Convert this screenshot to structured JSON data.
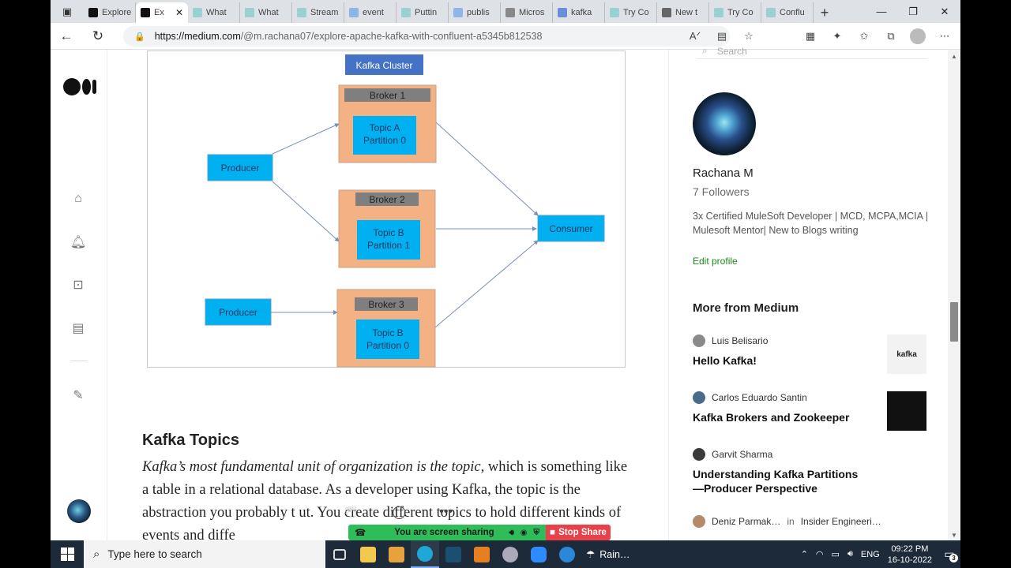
{
  "browser": {
    "tabs": [
      {
        "label": "Explore",
        "fav": "#111111"
      },
      {
        "label": "Ex",
        "fav": "#111111",
        "active": true
      },
      {
        "label": "What",
        "fav": "#9ad0d0"
      },
      {
        "label": "What",
        "fav": "#9ad0d0"
      },
      {
        "label": "Stream",
        "fav": "#9ad0d0"
      },
      {
        "label": "event",
        "fav": "#8fb4e8"
      },
      {
        "label": "Puttin",
        "fav": "#9ad0d0"
      },
      {
        "label": "publis",
        "fav": "#8fb4e8"
      },
      {
        "label": "Micros",
        "fav": "#888888"
      },
      {
        "label": "kafka",
        "fav": "#6a8fd6"
      },
      {
        "label": "Try Co",
        "fav": "#9ad0d0"
      },
      {
        "label": "New t",
        "fav": "#666666"
      },
      {
        "label": "Try Co",
        "fav": "#9ad0d0"
      },
      {
        "label": "Conflu",
        "fav": "#9ad0d0"
      }
    ],
    "url_host": "https://medium.com",
    "url_path": "/@m.rachana07/explore-apache-kafka-with-confluent-a5345b812538"
  },
  "diagram": {
    "cluster_label": "Kafka Cluster",
    "brokers": [
      {
        "label": "Broker 1",
        "topic": "Topic A",
        "partition": "Partition 0"
      },
      {
        "label": "Broker 2",
        "topic": "Topic B",
        "partition": "Partition 1"
      },
      {
        "label": "Broker 3",
        "topic": "Topic B",
        "partition": "Partition 0"
      }
    ],
    "producer_label": "Producer",
    "consumer_label": "Consumer"
  },
  "article": {
    "heading": "Kafka Topics",
    "lede": "Kafka’s most fundamental unit of organization is the topic,",
    "body": " which is something like a table in a relational database. As a developer using Kafka, the topic is the abstraction you probably t",
    "body_after_overlay": "ut. You create different topics to hold different kinds of events and diffe"
  },
  "sidebar": {
    "search_placeholder": "Search",
    "author_name": "Rachana M",
    "followers": "7 Followers",
    "bio": "3x Certified MuleSoft Developer | MCD, MCPA,MCIA | Mulesoft Mentor| New to Blogs writing",
    "edit_profile": "Edit profile",
    "more_heading": "More from Medium",
    "recommendations": [
      {
        "author": "Luis Belisario",
        "title": "Hello Kafka!",
        "thumb_text": "kafka"
      },
      {
        "author": "Carlos Eduardo Santin",
        "title": "Kafka Brokers and Zookeeper"
      },
      {
        "author": "Garvit Sharma",
        "title": "Understanding Kafka Partitions —Producer Perspective"
      },
      {
        "author": "Deniz Parmak…",
        "publication_prefix": "in",
        "publication": "Insider Engineeri…"
      }
    ]
  },
  "screen_share": {
    "message": "You are screen sharing",
    "stop_label": "Stop Share"
  },
  "taskbar": {
    "search_placeholder": "Type here to search",
    "weather": "Rain…",
    "language": "ENG",
    "time": "09:22 PM",
    "date": "16-10-2022",
    "notification_count": "3"
  }
}
